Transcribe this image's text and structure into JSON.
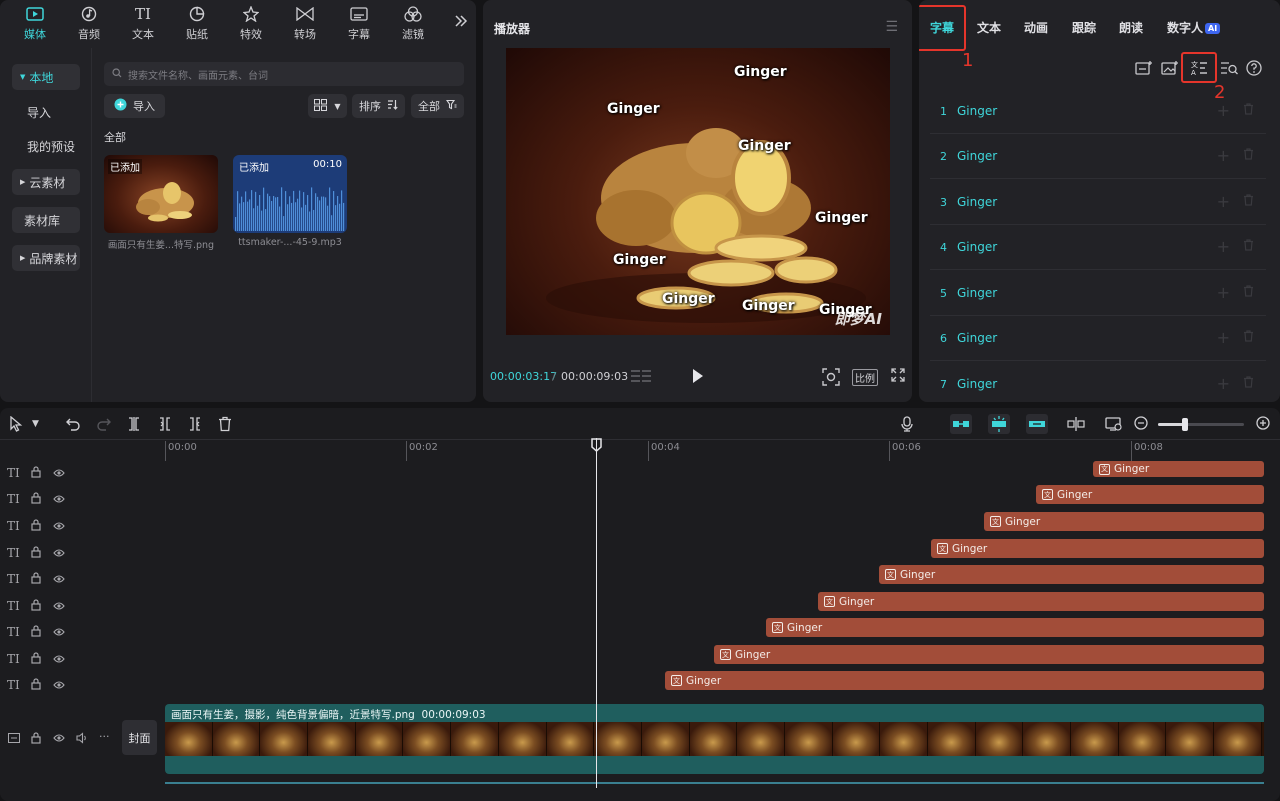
{
  "top_tabs": [
    {
      "label": "媒体",
      "icon": "media-icon"
    },
    {
      "label": "音频",
      "icon": "audio-icon"
    },
    {
      "label": "文本",
      "icon": "text-icon"
    },
    {
      "label": "贴纸",
      "icon": "sticker-icon"
    },
    {
      "label": "特效",
      "icon": "effects-icon"
    },
    {
      "label": "转场",
      "icon": "transition-icon"
    },
    {
      "label": "字幕",
      "icon": "subtitle-icon"
    },
    {
      "label": "滤镜",
      "icon": "filter-icon"
    }
  ],
  "media_sidebar": {
    "local": "本地",
    "import": "导入",
    "my_presets": "我的预设",
    "cloud": "云素材",
    "library": "素材库",
    "brand": "品牌素材"
  },
  "media": {
    "search_placeholder": "搜索文件名称、画面元素、台词",
    "import_label": "导入",
    "sort_label": "排序",
    "all_filter_label": "全部",
    "section_label": "全部",
    "items": [
      {
        "badge": "已添加",
        "name": "画面只有生姜...特写.png",
        "duration": ""
      },
      {
        "badge": "已添加",
        "name": "ttsmaker-...-45-9.mp3",
        "duration": "00:10"
      }
    ]
  },
  "player": {
    "title": "播放器",
    "current_time": "00:00:03:17",
    "separator": "/",
    "total_time": "00:00:09:03",
    "ratio_label": "比例",
    "overlay_texts": [
      "Ginger",
      "Ginger",
      "Ginger",
      "Ginger",
      "Ginger",
      "Ginger",
      "Ginger",
      "Ginger"
    ],
    "watermark": "即梦AI"
  },
  "right_panel": {
    "tabs": [
      "字幕",
      "文本",
      "动画",
      "跟踪",
      "朗读",
      "数字人"
    ],
    "ai_badge": "AI",
    "annotation_1": "1",
    "annotation_2": "2",
    "subtitles": [
      {
        "index": "1",
        "text": "Ginger"
      },
      {
        "index": "2",
        "text": "Ginger"
      },
      {
        "index": "3",
        "text": "Ginger"
      },
      {
        "index": "4",
        "text": "Ginger"
      },
      {
        "index": "5",
        "text": "Ginger"
      },
      {
        "index": "6",
        "text": "Ginger"
      },
      {
        "index": "7",
        "text": "Ginger"
      }
    ]
  },
  "timeline": {
    "ruler": [
      "00:00",
      "00:02",
      "00:04",
      "00:06",
      "00:08"
    ],
    "text_clips": [
      "Ginger",
      "Ginger",
      "Ginger",
      "Ginger",
      "Ginger",
      "Ginger",
      "Ginger",
      "Ginger",
      "Ginger"
    ],
    "main_clip_label": "画面只有生姜，摄影，纯色背景偏暗，近景特写.png",
    "main_clip_duration": "00:00:09:03",
    "cover_label": "封面"
  },
  "colors": {
    "accent": "#3fd6da",
    "annotation_red": "#e5352b",
    "text_clip": "#a24d39",
    "main_clip": "#1f5e5e",
    "panel_bg": "#222226"
  }
}
